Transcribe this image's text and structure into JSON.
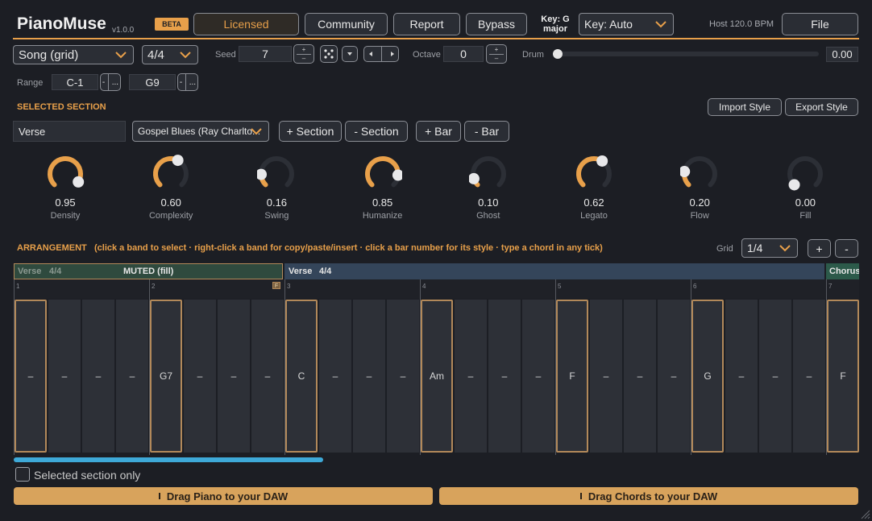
{
  "app": {
    "name": "PianoMuse",
    "version": "v1.0.0",
    "beta": "BETA"
  },
  "toolbar": {
    "licensed": "Licensed",
    "community": "Community",
    "report": "Report",
    "bypass": "Bypass",
    "key_line1": "Key: G",
    "key_line2": "major",
    "key_select": "Key: Auto",
    "host": "Host 120.0 BPM",
    "file": "File"
  },
  "controls": {
    "mode": "Song (grid)",
    "meter": "4/4",
    "seed_label": "Seed",
    "seed_value": "7",
    "octave_label": "Octave",
    "octave_value": "0",
    "drum_label": "Drum",
    "drum_value": "0.00",
    "drum_level": 0.0,
    "range_label": "Range",
    "range_low": "C-1",
    "range_high": "G9",
    "stepper_minus": "-",
    "stepper_dots": "..."
  },
  "section": {
    "heading": "SELECTED SECTION",
    "import_style": "Import Style",
    "export_style": "Export Style",
    "name": "Verse",
    "style": "Gospel Blues (Ray Charlto...",
    "add_section": "+ Section",
    "remove_section": "- Section",
    "add_bar": "+ Bar",
    "remove_bar": "- Bar"
  },
  "knobs": [
    {
      "label": "Density",
      "value": "0.95",
      "level": 0.95
    },
    {
      "label": "Complexity",
      "value": "0.60",
      "level": 0.6
    },
    {
      "label": "Swing",
      "value": "0.16",
      "level": 0.16
    },
    {
      "label": "Humanize",
      "value": "0.85",
      "level": 0.85
    },
    {
      "label": "Ghost",
      "value": "0.10",
      "level": 0.1
    },
    {
      "label": "Legato",
      "value": "0.62",
      "level": 0.62
    },
    {
      "label": "Flow",
      "value": "0.20",
      "level": 0.2
    },
    {
      "label": "Fill",
      "value": "0.00",
      "level": 0.0
    }
  ],
  "arrangement": {
    "heading": "ARRANGEMENT",
    "hint": "(click a band to select · right-click a band for copy/paste/insert · click a bar number for its style · type a chord in any tick)",
    "grid_label": "Grid",
    "grid_value": "1/4",
    "plus": "+",
    "minus": "-",
    "bands": [
      {
        "name": "Verse",
        "meter": "4/4",
        "status": "MUTED (fill)"
      },
      {
        "name": "Verse",
        "meter": "4/4",
        "status": ""
      },
      {
        "name": "Chorus",
        "meter": "",
        "status": ""
      }
    ],
    "bar_numbers": [
      "1",
      "2",
      "3",
      "4",
      "5",
      "6",
      "7"
    ],
    "fill_marker": "F",
    "ticks": [
      "–",
      "–",
      "–",
      "–",
      "G7",
      "–",
      "–",
      "–",
      "C",
      "–",
      "–",
      "–",
      "Am",
      "–",
      "–",
      "–",
      "F",
      "–",
      "–",
      "–",
      "G",
      "–",
      "–",
      "–",
      "F"
    ]
  },
  "footer": {
    "selected_only": "Selected section only",
    "drag_piano": "Drag Piano to your DAW",
    "drag_chords": "Drag Chords to your DAW"
  },
  "colors": {
    "accent": "#e8a04a",
    "background": "#1c1e24",
    "scroll": "#3ea9d8",
    "muted_band": "#2f4a3e",
    "verse_band": "#34455a",
    "chorus_band": "#2c5a4a"
  }
}
